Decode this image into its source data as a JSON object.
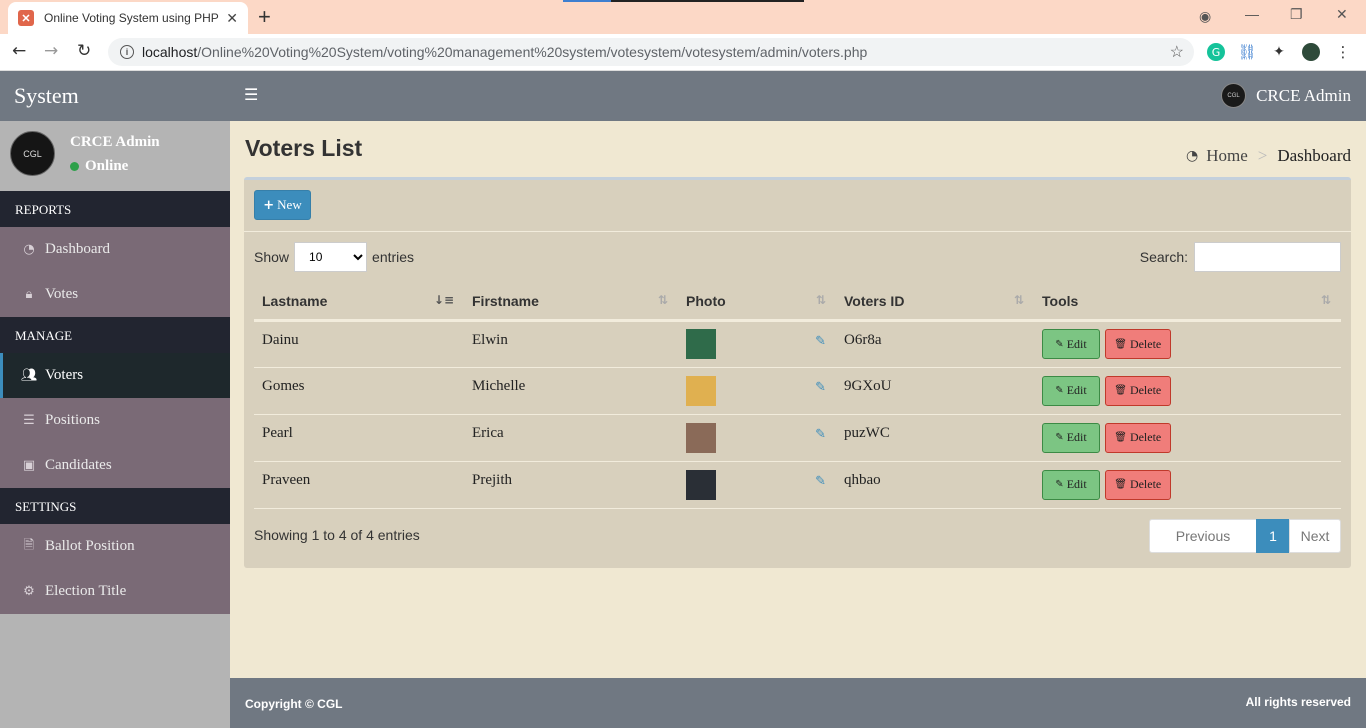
{
  "browser": {
    "tab_title": "Online Voting System using PHP",
    "url_host": "localhost",
    "url_path": "/Online%20Voting%20System/voting%20management%20system/votesystem/votesystem/admin/voters.php"
  },
  "header": {
    "logo_text": "System",
    "user_name": "CRCE Admin",
    "avatar_text": "CGL"
  },
  "sidebar": {
    "user_name": "CRCE Admin",
    "status": "Online",
    "sections": [
      {
        "title": "REPORTS",
        "items": [
          {
            "label": "Dashboard",
            "icon": "dashboard-icon"
          },
          {
            "label": "Votes",
            "icon": "lock-icon"
          }
        ]
      },
      {
        "title": "MANAGE",
        "items": [
          {
            "label": "Voters",
            "icon": "users-icon"
          },
          {
            "label": "Positions",
            "icon": "tasks-icon"
          },
          {
            "label": "Candidates",
            "icon": "id-badge-icon"
          }
        ]
      },
      {
        "title": "SETTINGS",
        "items": [
          {
            "label": "Ballot Position",
            "icon": "file-icon"
          },
          {
            "label": "Election Title",
            "icon": "cogs-icon"
          }
        ]
      }
    ]
  },
  "content": {
    "page_title": "Voters List",
    "breadcrumb": {
      "home": "Home",
      "current": "Dashboard"
    },
    "new_button": "New",
    "show_label": "Show",
    "entries_label": "entries",
    "page_length": "10",
    "search_label": "Search:",
    "columns": [
      "Lastname",
      "Firstname",
      "Photo",
      "Voters ID",
      "Tools"
    ],
    "rows": [
      {
        "lastname": "Dainu",
        "firstname": "Elwin",
        "voters_id": "O6r8a",
        "photo_color": "#2f6b4a"
      },
      {
        "lastname": "Gomes",
        "firstname": "Michelle",
        "voters_id": "9GXoU",
        "photo_color": "#e0b050"
      },
      {
        "lastname": "Pearl",
        "firstname": "Erica",
        "voters_id": "puzWC",
        "photo_color": "#8a6a58"
      },
      {
        "lastname": "Praveen",
        "firstname": "Prejith",
        "voters_id": "qhbao",
        "photo_color": "#2a2f36"
      }
    ],
    "edit_label": "Edit",
    "delete_label": "Delete",
    "info": "Showing 1 to 4 of 4 entries",
    "pagination": {
      "previous": "Previous",
      "page": "1",
      "next": "Next"
    }
  },
  "footer": {
    "copyright": "Copyright © CGL",
    "rights": "All rights reserved"
  },
  "colors": {
    "accent": "#3c8dbc",
    "header": "#707882",
    "sidebar_item": "#7a6a76",
    "edit": "#7cc583",
    "delete": "#f07d7a"
  }
}
